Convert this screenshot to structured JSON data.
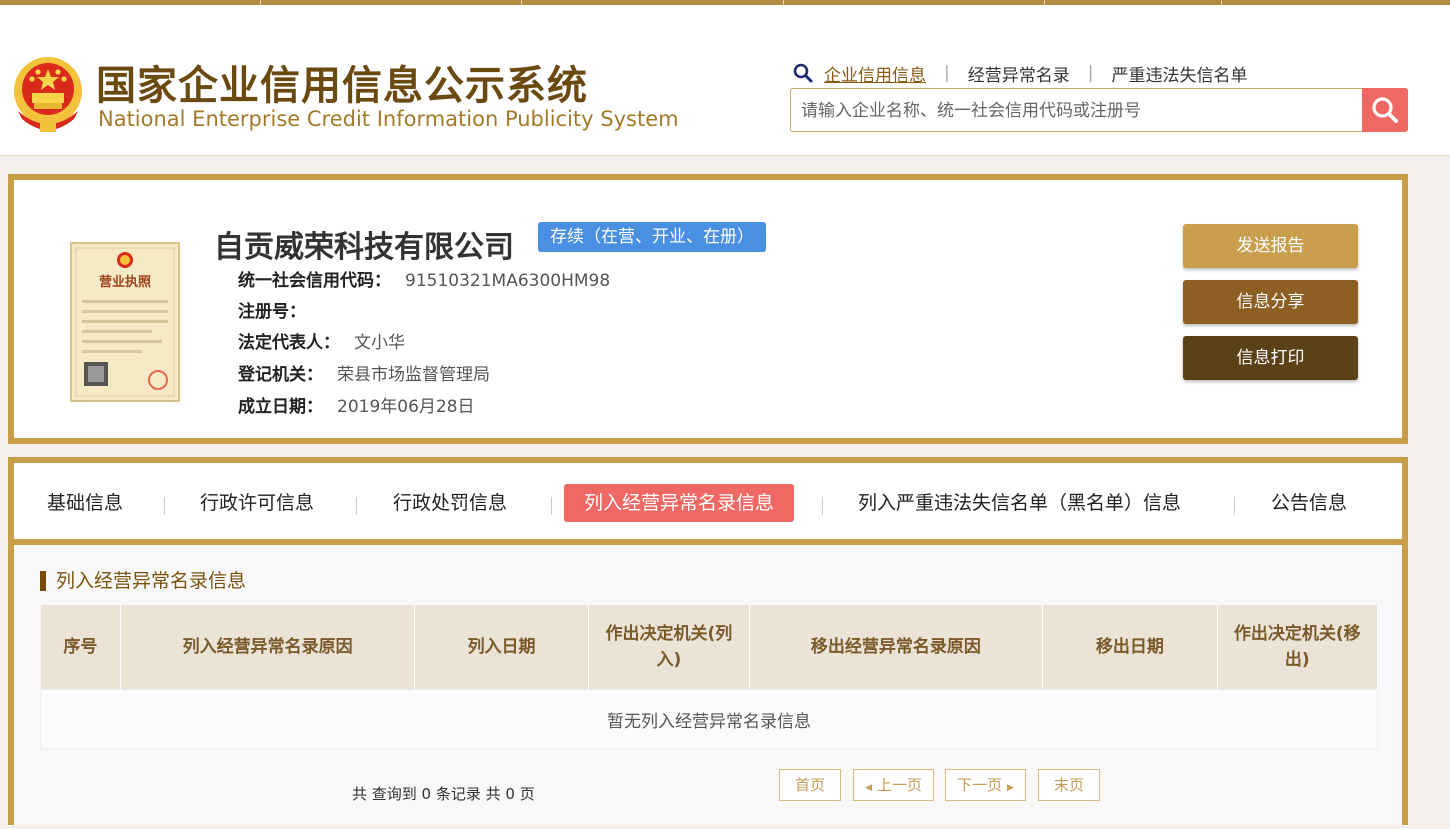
{
  "header": {
    "title_cn": "国家企业信用信息公示系统",
    "title_en": "National Enterprise Credit Information Publicity System",
    "nav": [
      "企业信用信息",
      "经营异常名录",
      "严重违法失信名单"
    ],
    "search_placeholder": "请输入企业名称、统一社会信用代码或注册号",
    "accent": "#b08a3e",
    "search_button_color": "#ef6863",
    "icons": [
      "national-emblem-icon",
      "magnifier-icon",
      "search-icon"
    ]
  },
  "company": {
    "name": "自贡威荣科技有限公司",
    "status": "存续（在营、开业、在册）",
    "license_icon": "business-license-icon",
    "license_text": "营业执照",
    "fields": [
      {
        "label": "统一社会信用代码：",
        "value": "91510321MA6300HM98"
      },
      {
        "label": "注册号：",
        "value": ""
      },
      {
        "label": "法定代表人：",
        "value": "文小华"
      },
      {
        "label": "登记机关：",
        "value": "荣县市场监督管理局"
      },
      {
        "label": "成立日期：",
        "value": "2019年06月28日"
      }
    ],
    "actions": [
      {
        "label": "发送报告",
        "color": "#c99e4d"
      },
      {
        "label": "信息分享",
        "color": "#8e5f22"
      },
      {
        "label": "信息打印",
        "color": "#5c4117"
      }
    ]
  },
  "tabs": [
    {
      "label": "基础信息",
      "active": false
    },
    {
      "label": "行政许可信息",
      "active": false
    },
    {
      "label": "行政处罚信息",
      "active": false
    },
    {
      "label": "列入经营异常名录信息",
      "active": true
    },
    {
      "label": "列入严重违法失信名单（黑名单）信息",
      "active": false
    },
    {
      "label": "公告信息",
      "active": false
    }
  ],
  "section": {
    "title": "列入经营异常名录信息",
    "columns": [
      "序号",
      "列入经营异常名录原因",
      "列入日期",
      "作出决定机关(列入)",
      "移出经营异常名录原因",
      "移出日期",
      "作出决定机关(移出)"
    ],
    "empty_text": "暂无列入经营异常名录信息"
  },
  "pager": {
    "summary": "共 查询到 0 条记录 共 0 页",
    "first": "首页",
    "prev": "上一页",
    "next": "下一页",
    "last": "末页"
  }
}
